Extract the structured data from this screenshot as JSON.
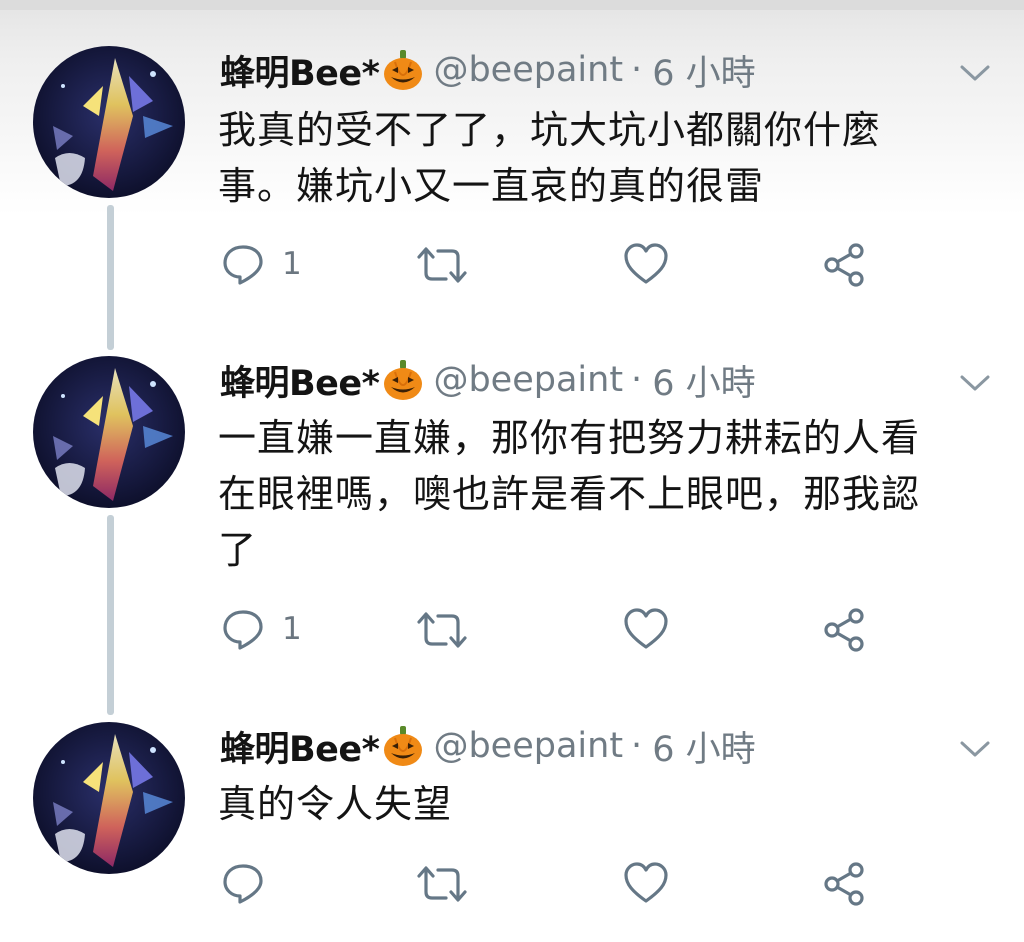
{
  "colors": {
    "accent": "#657786",
    "thread_line": "#c4cfd6",
    "text": "#141414",
    "muted": "#707b84"
  },
  "icons": {
    "reply": "reply-icon",
    "retweet": "retweet-icon",
    "like": "heart-icon",
    "share": "share-icon",
    "more": "chevron-down-icon",
    "emoji": "pumpkin-emoji"
  },
  "tweets": [
    {
      "name": "蜂明Bee*",
      "handle": "@beepaint",
      "separator": "·",
      "time": "6 小時",
      "text": "我真的受不了了，坑大坑小都關你什麼\n事。嫌坑小又一直哀的真的很雷",
      "reply_count": "1"
    },
    {
      "name": "蜂明Bee*",
      "handle": "@beepaint",
      "separator": "·",
      "time": "6 小時",
      "text": "一直嫌一直嫌，那你有把努力耕耘的人看\n在眼裡嗎，噢也許是看不上眼吧，那我認\n了",
      "reply_count": "1"
    },
    {
      "name": "蜂明Bee*",
      "handle": "@beepaint",
      "separator": "·",
      "time": "6 小時",
      "text": "真的令人失望",
      "reply_count": ""
    }
  ]
}
